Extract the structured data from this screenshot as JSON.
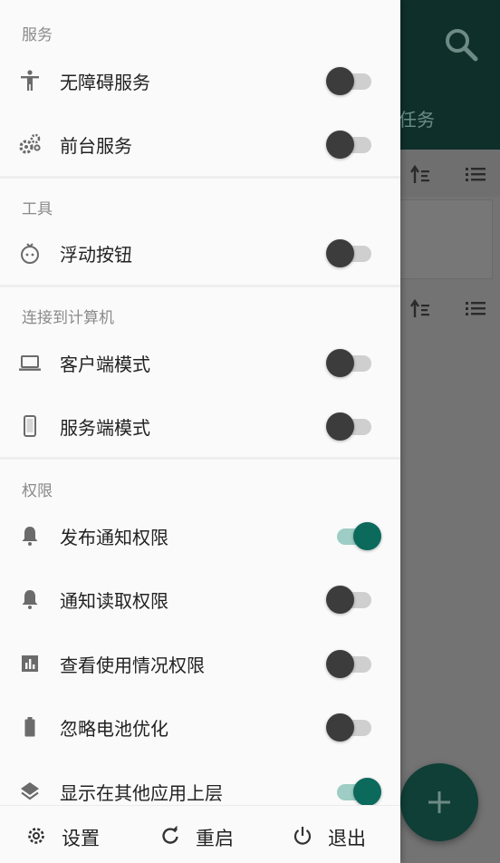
{
  "background": {
    "tab_text": "任务"
  },
  "sections": [
    {
      "title": "服务",
      "items": [
        {
          "label": "无障碍服务",
          "icon": "accessibility-icon",
          "on": false
        },
        {
          "label": "前台服务",
          "icon": "gears-icon",
          "on": false
        }
      ]
    },
    {
      "title": "工具",
      "items": [
        {
          "label": "浮动按钮",
          "icon": "floating-face-icon",
          "on": false
        }
      ]
    },
    {
      "title": "连接到计算机",
      "items": [
        {
          "label": "客户端模式",
          "icon": "laptop-icon",
          "on": false
        },
        {
          "label": "服务端模式",
          "icon": "phone-icon",
          "on": false
        }
      ]
    },
    {
      "title": "权限",
      "items": [
        {
          "label": "发布通知权限",
          "icon": "bell-icon",
          "on": true
        },
        {
          "label": "通知读取权限",
          "icon": "bell-icon",
          "on": false
        },
        {
          "label": "查看使用情况权限",
          "icon": "usage-chart-icon",
          "on": false
        },
        {
          "label": "忽略电池优化",
          "icon": "battery-icon",
          "on": false
        },
        {
          "label": "显示在其他应用上层",
          "icon": "layers-icon",
          "on": true
        }
      ]
    }
  ],
  "bottom": {
    "settings": "设置",
    "restart": "重启",
    "exit": "退出"
  },
  "colors": {
    "accent": "#0b6a5c",
    "accent_track": "#9dcdc4",
    "appbar_dim": "#0f2f2a"
  }
}
